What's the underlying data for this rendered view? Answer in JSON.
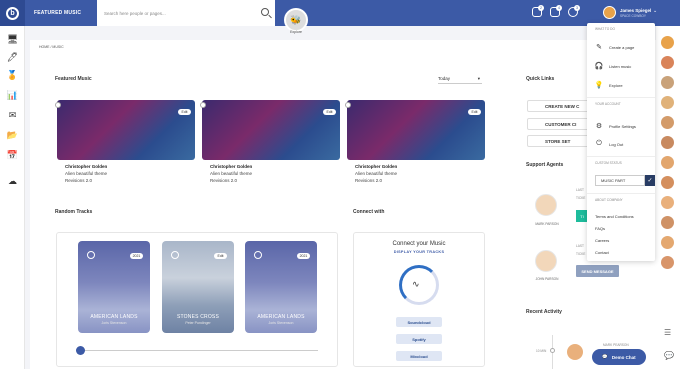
{
  "header": {
    "title": "FEATURED MUSIC",
    "search_placeholder": "Search here people or pages...",
    "explore_label": "Explore",
    "badges": [
      "2",
      "4",
      "3"
    ],
    "user_name": "James Spiegel",
    "user_role": "SPACE COWBOY"
  },
  "breadcrumb": "HOME  /  MUSIC",
  "featured": {
    "title": "Featured Music",
    "sort": "Today",
    "edit_label": "Edit",
    "items": [
      {
        "artist": "Christopher Golden",
        "title": "Alien beautiful theme",
        "revisions": "Revisions 2.0"
      },
      {
        "artist": "Christopher Golden",
        "title": "Alien beautiful theme",
        "revisions": "Revisions 2.0"
      },
      {
        "artist": "Christopher Golden",
        "title": "Alien beautiful theme",
        "revisions": "Revisions 2.0"
      }
    ]
  },
  "random_tracks": {
    "title": "Random Tracks",
    "items": [
      {
        "name": "AMERICAN LANDS",
        "artist": "Joris Stevenson",
        "badge": "2021"
      },
      {
        "name": "STONES CROSS",
        "artist": "Peter Pundinger",
        "badge": "Edit"
      },
      {
        "name": "AMERICAN LANDS",
        "artist": "Joris Stevenson",
        "badge": "2021"
      }
    ],
    "slider_position": 0.02
  },
  "connect": {
    "title": "Connect with",
    "heading": "Connect your Music",
    "subheading": "DISPLAY YOUR TRACKS",
    "services": [
      "Soundcloud",
      "Spotify",
      "Mixcloud"
    ]
  },
  "quick_links": {
    "title": "Quick Links",
    "buttons": [
      "CREATE NEW C",
      "CUSTOMER CI",
      "STORE SET"
    ]
  },
  "support": {
    "title": "Support Agents",
    "agents": [
      {
        "name": "MARK PARSON",
        "label": "LAST",
        "sub": "TICKE",
        "short": "TI"
      },
      {
        "name": "JOHN PARSON",
        "label": "LAST",
        "sub": "TICKE"
      }
    ],
    "send_label": "SEND MESSAGE"
  },
  "recent": {
    "title": "Recent Activity",
    "time": "10 MIN",
    "name": "MARK PEARSON"
  },
  "dropdown": {
    "what_to_do": "WHAT TO DO",
    "items": [
      "Create a page",
      "Listen music",
      "Explore"
    ],
    "your_account": "YOUR ACCOUNT",
    "account_items": [
      "Profile Settings",
      "Log Out"
    ],
    "custom_status": "CUSTOM STATUS",
    "status_value": "MUSIC PART",
    "about_company": "ABOUT COMPANY",
    "company_links": [
      "Terms and Conditions",
      "FAQs",
      "Careers",
      "Contact"
    ]
  },
  "demo_chat": "Demo Chat",
  "colors": {
    "primary": "#3c5aa6",
    "dark": "#283c64"
  }
}
